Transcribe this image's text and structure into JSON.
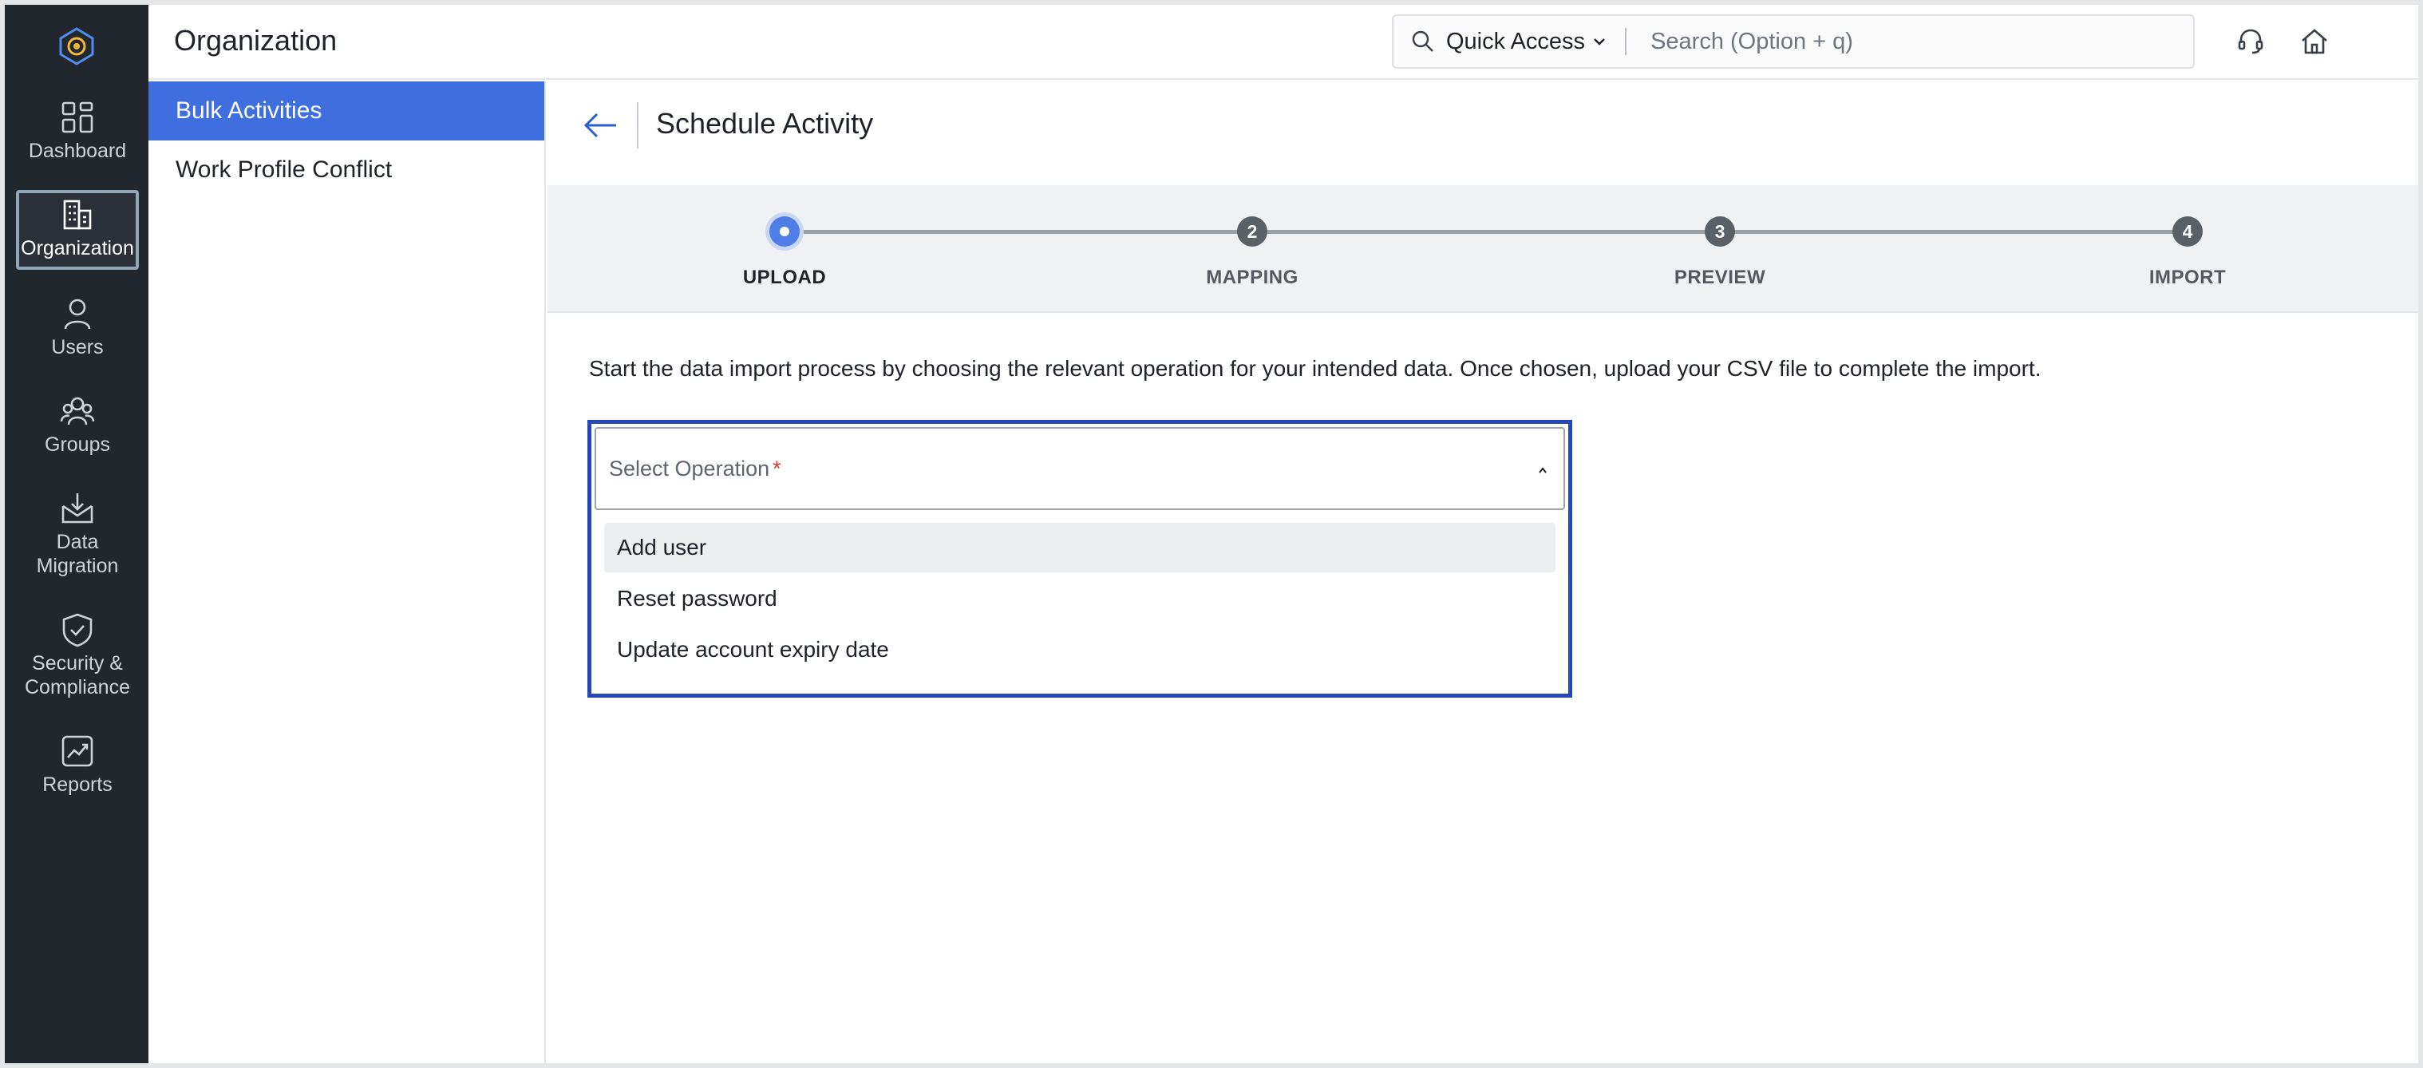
{
  "header": {
    "title": "Organization",
    "quick_access_label": "Quick Access",
    "search_placeholder": "Search (Option + q)"
  },
  "rail": {
    "items": [
      {
        "label": "Dashboard",
        "icon": "dashboard-icon"
      },
      {
        "label": "Organization",
        "icon": "building-icon",
        "active": true
      },
      {
        "label": "Users",
        "icon": "user-icon"
      },
      {
        "label": "Groups",
        "icon": "groups-icon"
      },
      {
        "label": "Data",
        "label2": "Migration",
        "icon": "data-migration-icon"
      },
      {
        "label": "Security &",
        "label2": "Compliance",
        "icon": "shield-check-icon"
      },
      {
        "label": "Reports",
        "icon": "reports-icon"
      }
    ]
  },
  "subnav": {
    "items": [
      {
        "label": "Bulk Activities",
        "active": true
      },
      {
        "label": "Work Profile Conflict"
      }
    ]
  },
  "page": {
    "title": "Schedule Activity",
    "intro": "Start the data import process by choosing the relevant operation for your intended data. Once chosen, upload your CSV file to complete the import."
  },
  "stepper": {
    "steps": [
      {
        "number": "",
        "label": "UPLOAD",
        "current": true
      },
      {
        "number": "2",
        "label": "MAPPING"
      },
      {
        "number": "3",
        "label": "PREVIEW"
      },
      {
        "number": "4",
        "label": "IMPORT"
      }
    ]
  },
  "operation": {
    "placeholder": "Select Operation",
    "required_mark": "*",
    "options": [
      "Add user",
      "Reset password",
      "Update account expiry date"
    ]
  },
  "colors": {
    "rail_bg": "#22262d",
    "accent": "#3f6ede",
    "focus_border": "#2348b7",
    "current_step": "#4f7de8"
  }
}
